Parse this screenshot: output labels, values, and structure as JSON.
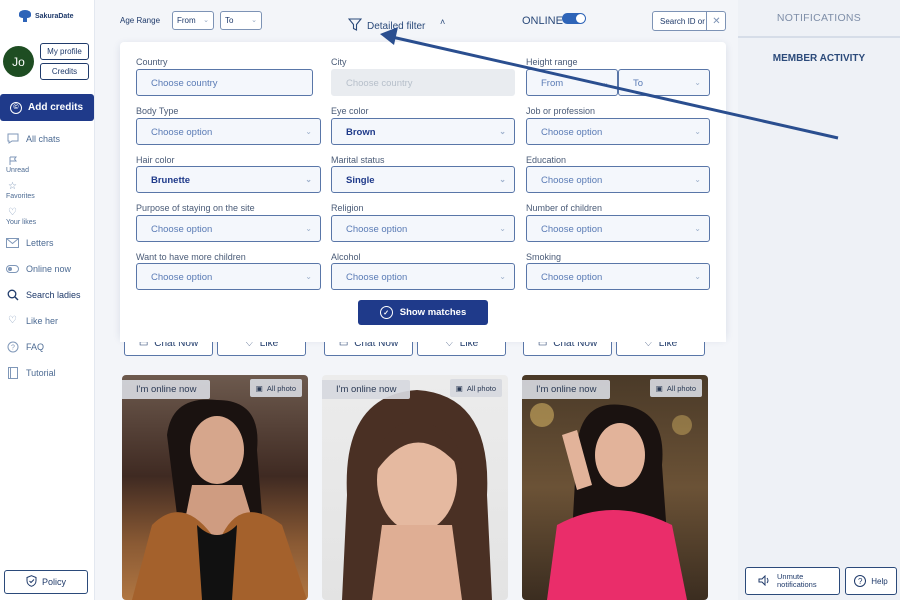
{
  "brand": {
    "name": "SakuraDate"
  },
  "user": {
    "initials": "Jo",
    "my_profile_label": "My profile",
    "credits_label": "Credits"
  },
  "sidebar": {
    "add_credits_label": "Add credits",
    "items": [
      {
        "label": "All chats",
        "icon": "chat-icon"
      },
      {
        "label": "Unread",
        "icon": "flag-icon"
      },
      {
        "label": "Favorites",
        "icon": "star-icon"
      },
      {
        "label": "Your likes",
        "icon": "heart-icon"
      },
      {
        "label": "Letters",
        "icon": "mail-icon"
      },
      {
        "label": "Online now",
        "icon": "online-toggle-icon"
      },
      {
        "label": "Search ladies",
        "icon": "search-icon"
      },
      {
        "label": "Like her",
        "icon": "heart-icon"
      },
      {
        "label": "FAQ",
        "icon": "question-icon"
      },
      {
        "label": "Tutorial",
        "icon": "book-icon"
      }
    ],
    "policy_label": "Policy"
  },
  "topbar": {
    "age_range_label": "Age Range",
    "from_value": "From",
    "to_value": "To",
    "detailed_filter_label": "Detailed filter",
    "online_label": "ONLINE",
    "online_on": true,
    "search_placeholder": "Search ID or"
  },
  "filters": {
    "country": {
      "label": "Country",
      "value": "Choose country"
    },
    "city": {
      "label": "City",
      "value": "Choose country"
    },
    "height": {
      "label": "Height range",
      "from": "From",
      "to": "To"
    },
    "body_type": {
      "label": "Body Type",
      "value": "Choose option"
    },
    "eye_color": {
      "label": "Eye color",
      "value": "Brown"
    },
    "job": {
      "label": "Job or profession",
      "value": "Choose option"
    },
    "hair_color": {
      "label": "Hair color",
      "value": "Brunette"
    },
    "marital": {
      "label": "Marital status",
      "value": "Single"
    },
    "education": {
      "label": "Education",
      "value": "Choose option"
    },
    "purpose": {
      "label": "Purpose of staying on the site",
      "value": "Choose option"
    },
    "religion": {
      "label": "Religion",
      "value": "Choose option"
    },
    "children": {
      "label": "Number of children",
      "value": "Choose option"
    },
    "more_children": {
      "label": "Want to have more children",
      "value": "Choose option"
    },
    "alcohol": {
      "label": "Alcohol",
      "value": "Choose option"
    },
    "smoking": {
      "label": "Smoking",
      "value": "Choose option"
    },
    "show_matches_label": "Show matches"
  },
  "cards": [
    {
      "online_label": "I'm online now",
      "all_photo_label": "All photo",
      "chat_label": "Chat Now",
      "like_label": "Like"
    },
    {
      "online_label": "I'm online now",
      "all_photo_label": "All photo",
      "chat_label": "Chat Now",
      "like_label": "Like"
    },
    {
      "online_label": "I'm online now",
      "all_photo_label": "All photo",
      "chat_label": "Chat Now",
      "like_label": "Like"
    }
  ],
  "right_panel": {
    "notifications_label": "NOTIFICATIONS",
    "member_activity_label": "MEMBER ACTIVITY",
    "unmute_line1": "Unmute",
    "unmute_line2": "notifications",
    "help_label": "Help"
  },
  "colors": {
    "primary": "#1f3a8a",
    "accent": "#2e64b8",
    "text": "#1f3a6a"
  }
}
